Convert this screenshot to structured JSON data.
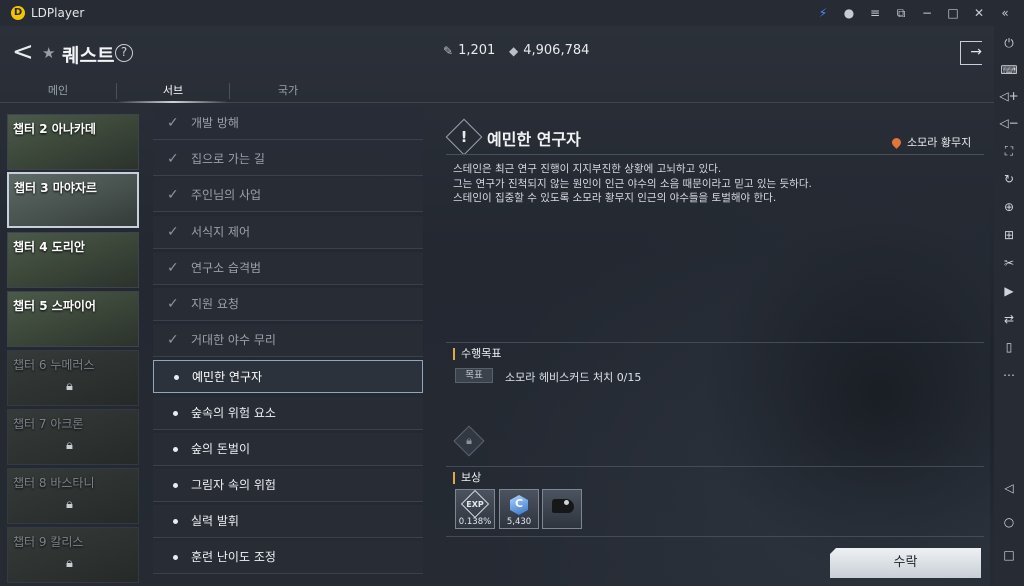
{
  "window": {
    "app_title": "LDPlayer"
  },
  "titlebar_icons": [
    "bolt-icon",
    "user-icon",
    "menu-icon",
    "window-icon",
    "minimize-icon",
    "maximize-icon",
    "close-icon",
    "collapse-icon"
  ],
  "header": {
    "title": "퀘스트",
    "help_symbol": "?",
    "currency1": "1,201",
    "currency2": "4,906,784"
  },
  "tabs": [
    "메인",
    "서브",
    "국가"
  ],
  "active_tab": "서브",
  "chapters": [
    {
      "label": "챕터 2 아나카데",
      "locked": false
    },
    {
      "label": "챕터 3 마야자르",
      "locked": false,
      "selected": true
    },
    {
      "label": "챕터 4 도리안",
      "locked": false
    },
    {
      "label": "챕터 5 스파이어",
      "locked": false
    },
    {
      "label": "챕터 6 누메러스",
      "locked": true
    },
    {
      "label": "챕터 7 아크론",
      "locked": true
    },
    {
      "label": "챕터 8 바스타니",
      "locked": true
    },
    {
      "label": "챕터 9 칼리스",
      "locked": true
    }
  ],
  "quests": [
    {
      "label": "개발 방해",
      "status": "done"
    },
    {
      "label": "집으로 가는 길",
      "status": "done"
    },
    {
      "label": "주인님의 사업",
      "status": "done"
    },
    {
      "label": "서식지 제어",
      "status": "done"
    },
    {
      "label": "연구소 습격범",
      "status": "done"
    },
    {
      "label": "지원 요청",
      "status": "done"
    },
    {
      "label": "거대한 야수 무리",
      "status": "done"
    },
    {
      "label": "예민한 연구자",
      "status": "selected"
    },
    {
      "label": "숲속의 위험 요소",
      "status": "todo"
    },
    {
      "label": "숲의 돈벌이",
      "status": "todo"
    },
    {
      "label": "그림자 속의 위험",
      "status": "todo"
    },
    {
      "label": "실력 발휘",
      "status": "todo"
    },
    {
      "label": "훈련 난이도 조정",
      "status": "todo"
    }
  ],
  "detail": {
    "title": "예민한 연구자",
    "location": "소모라 황무지",
    "description": [
      "스테인은 최근 연구 진행이 지지부진한 상황에 고뇌하고 있다.",
      "그는 연구가 진척되지 않는 원인이 인근 야수의 소음 때문이라고 믿고 있는 듯하다.",
      "스테인이 집중할 수 있도록 소모라 황무지 인근의 야수들을 토벌해야 한다."
    ],
    "objective_header": "수행목표",
    "objective_tag": "목표",
    "objective_text": "소모라 헤비스커드 처치 0/15",
    "reward_header": "보상",
    "rewards": [
      {
        "icon": "exp-icon",
        "label": "EXP",
        "value": "0.138%"
      },
      {
        "icon": "coin-icon",
        "label": "C",
        "value": "5,430"
      },
      {
        "icon": "costume-icon",
        "label": "",
        "value": ""
      }
    ],
    "accept_label": "수락"
  },
  "side_icons": [
    "power-icon",
    "keyboard-icon",
    "volume-up-icon",
    "volume-down-icon",
    "screenshot-icon",
    "rotate-icon",
    "add-icon",
    "gamepad-icon",
    "scissors-icon",
    "record-icon",
    "sync-icon",
    "phone-icon",
    "more-icon",
    "back-nav-icon",
    "home-nav-icon",
    "recent-nav-icon"
  ]
}
